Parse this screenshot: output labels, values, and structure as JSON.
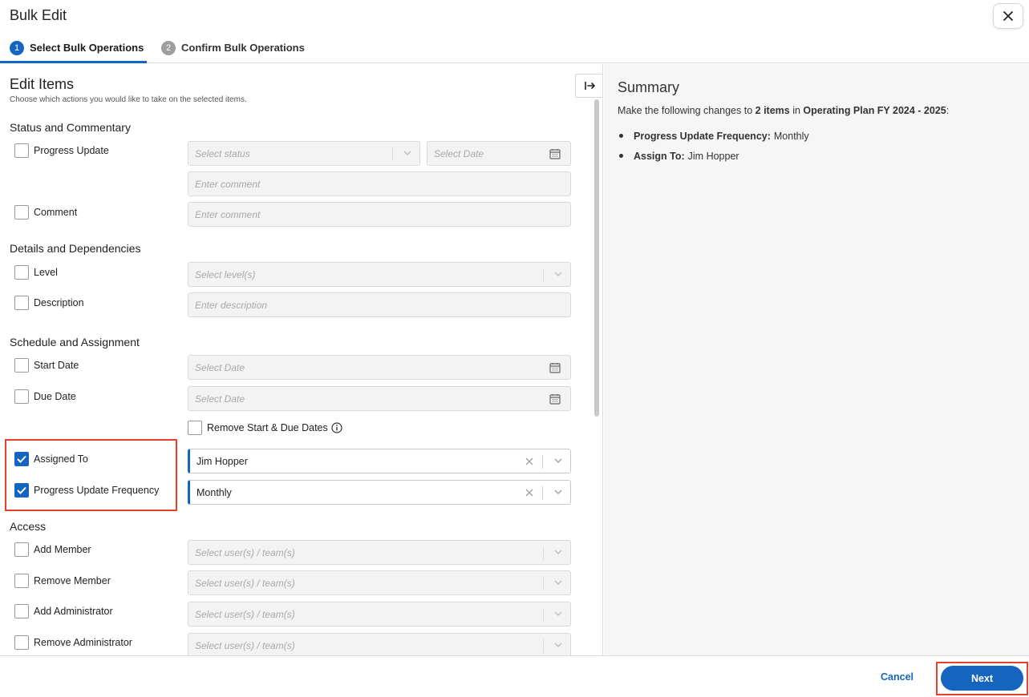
{
  "dialog": {
    "title": "Bulk Edit"
  },
  "steps": [
    {
      "number": "1",
      "label": "Select Bulk Operations",
      "active": true
    },
    {
      "number": "2",
      "label": "Confirm Bulk Operations",
      "active": false
    }
  ],
  "edit": {
    "title": "Edit Items",
    "subtitle": "Choose which actions you would like to take on the selected items.",
    "sections": {
      "status": "Status and Commentary",
      "details": "Details and Dependencies",
      "schedule": "Schedule and Assignment",
      "access": "Access"
    },
    "rows": {
      "progress_update": {
        "label": "Progress Update",
        "checked": false,
        "status_placeholder": "Select status",
        "date_placeholder": "Select Date",
        "comment_placeholder": "Enter comment"
      },
      "comment": {
        "label": "Comment",
        "checked": false,
        "placeholder": "Enter comment"
      },
      "level": {
        "label": "Level",
        "checked": false,
        "placeholder": "Select level(s)"
      },
      "description": {
        "label": "Description",
        "checked": false,
        "placeholder": "Enter description"
      },
      "start_date": {
        "label": "Start Date",
        "checked": false,
        "placeholder": "Select Date"
      },
      "due_date": {
        "label": "Due Date",
        "checked": false,
        "placeholder": "Select Date"
      },
      "remove_dates": {
        "label": "Remove Start & Due Dates",
        "checked": false
      },
      "assigned_to": {
        "label": "Assigned To",
        "checked": true,
        "value": "Jim Hopper"
      },
      "frequency": {
        "label": "Progress Update Frequency",
        "checked": true,
        "value": "Monthly"
      },
      "add_member": {
        "label": "Add Member",
        "checked": false,
        "placeholder": "Select user(s) / team(s)"
      },
      "remove_member": {
        "label": "Remove Member",
        "checked": false,
        "placeholder": "Select user(s) / team(s)"
      },
      "add_admin": {
        "label": "Add Administrator",
        "checked": false,
        "placeholder": "Select user(s) / team(s)"
      },
      "remove_admin": {
        "label": "Remove Administrator",
        "checked": false,
        "placeholder": "Select user(s) / team(s)"
      }
    }
  },
  "summary": {
    "title": "Summary",
    "intro_prefix": "Make the following changes to ",
    "item_count": "2 items",
    "intro_mid": " in ",
    "plan_name": "Operating Plan FY 2024 - 2025",
    "intro_suffix": ":",
    "items": [
      {
        "key": "Progress Update Frequency:",
        "value": "Monthly"
      },
      {
        "key": "Assign To:",
        "value": "Jim Hopper"
      }
    ]
  },
  "footer": {
    "cancel_label": "Cancel",
    "next_label": "Next"
  },
  "colors": {
    "accent": "#1565c0",
    "highlight": "#e8402a",
    "summary_bg": "#f6f6f6"
  }
}
